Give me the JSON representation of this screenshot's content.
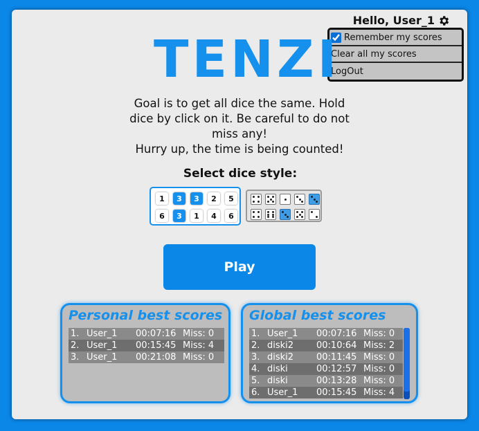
{
  "header": {
    "greeting": "Hello, User_1",
    "settings_icon": "gear-icon"
  },
  "menu": {
    "remember_label": "Remember my scores",
    "remember_checked": true,
    "clear_label": "Clear all my scores",
    "logout_label": "LogOut"
  },
  "title": "TENZI",
  "goal": {
    "line1": "Goal is to get all dice the same. Hold dice by click on it. Be careful to do not miss any!",
    "line2": "Hurry up, the time is being counted!"
  },
  "dice_style": {
    "label": "Select dice style:",
    "numeric_dice": [
      {
        "value": "1",
        "held": false
      },
      {
        "value": "3",
        "held": true
      },
      {
        "value": "3",
        "held": true
      },
      {
        "value": "2",
        "held": false
      },
      {
        "value": "5",
        "held": false
      },
      {
        "value": "6",
        "held": false
      },
      {
        "value": "3",
        "held": true
      },
      {
        "value": "1",
        "held": false
      },
      {
        "value": "4",
        "held": false
      },
      {
        "value": "6",
        "held": false
      }
    ],
    "pip_dice": [
      {
        "value": 4,
        "held": false
      },
      {
        "value": 5,
        "held": false
      },
      {
        "value": 1,
        "held": false
      },
      {
        "value": 3,
        "held": false
      },
      {
        "value": 3,
        "held": true
      },
      {
        "value": 4,
        "held": false
      },
      {
        "value": 6,
        "held": false
      },
      {
        "value": 3,
        "held": true
      },
      {
        "value": 5,
        "held": false
      },
      {
        "value": 2,
        "held": false
      }
    ]
  },
  "play_label": "Play",
  "personal": {
    "title": "Personal best scores",
    "rows": [
      {
        "rank": "1.",
        "user": "User_1",
        "time": "00:07:16",
        "miss": "Miss: 0"
      },
      {
        "rank": "2.",
        "user": "User_1",
        "time": "00:15:45",
        "miss": "Miss: 4"
      },
      {
        "rank": "3.",
        "user": "User_1",
        "time": "00:21:08",
        "miss": "Miss: 0"
      }
    ]
  },
  "global": {
    "title": "Global best scores",
    "rows": [
      {
        "rank": "1.",
        "user": "User_1",
        "time": "00:07:16",
        "miss": "Miss: 0"
      },
      {
        "rank": "2.",
        "user": "diski2",
        "time": "00:10:64",
        "miss": "Miss: 2"
      },
      {
        "rank": "3.",
        "user": "diski2",
        "time": "00:11:45",
        "miss": "Miss: 0"
      },
      {
        "rank": "4.",
        "user": "diski",
        "time": "00:12:57",
        "miss": "Miss: 0"
      },
      {
        "rank": "5.",
        "user": "diski",
        "time": "00:13:28",
        "miss": "Miss: 0"
      },
      {
        "rank": "6.",
        "user": "User_1",
        "time": "00:15:45",
        "miss": "Miss: 4"
      }
    ]
  },
  "colors": {
    "accent": "#1590ec",
    "background": "#0b87e8",
    "panel": "#ebebeb"
  }
}
